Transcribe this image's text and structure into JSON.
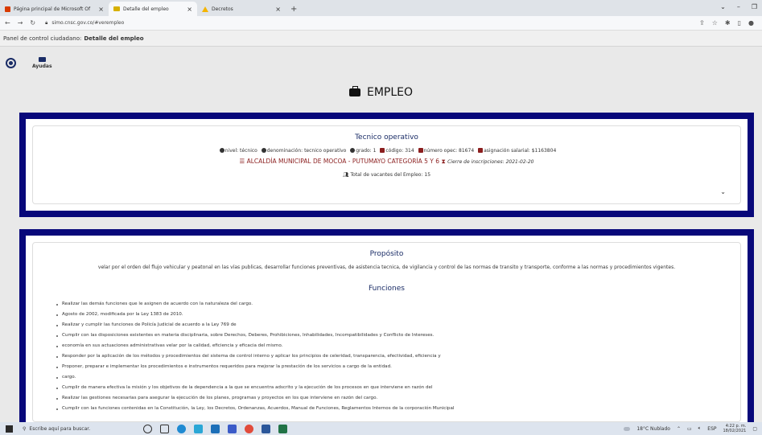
{
  "browser": {
    "tabs": [
      {
        "label": "Página principal de Microsoft Of",
        "icon": "office-icon",
        "color": "#d83b01"
      },
      {
        "label": "Detalle del empleo",
        "icon": "folder-icon",
        "color": "#d7b000",
        "active": true
      },
      {
        "label": "Decretos",
        "icon": "drive-icon",
        "color": "#f4b400"
      }
    ],
    "url": "simo.cnsc.gov.co/#verempleo"
  },
  "breadcrumb": {
    "prefix": "Panel de control ciudadano:",
    "current": "Detalle del empleo"
  },
  "help": {
    "label": "Ayudas"
  },
  "heading": {
    "title": "EMPLEO"
  },
  "job": {
    "title": "Tecnico operativo",
    "nivel": "nivel: técnico",
    "denominacion": "denominación: tecnico operativo",
    "grado": "grado: 1",
    "codigo": "código: 314",
    "numero_opec": "número opec: 81674",
    "asignacion": "asignación salarial: $1163804",
    "entity": "ALCALDÍA MUNICIPAL DE MOCOA - PUTUMAYO CATEGORÍA 5 Y 6",
    "cierre": "Cierre de inscripciones: 2021-02-20",
    "vacantes": "Total de vacantes del Empleo: 15"
  },
  "detail": {
    "purpose_title": "Propósito",
    "purpose": "velar por el orden del flujo vehicular y peatonal en las vías publicas, desarrollar funciones preventivas, de asistencia tecnica, de vigilancia y control de las normas de transito y transporte, conforme a las normas y procedimientos vigentes.",
    "functions_title": "Funciones",
    "functions": [
      "Realizar las demás funciones que le asignen de acuerdo con la naturaleza del cargo.",
      "Agosto de 2002, modificada por la Ley 1383 de 2010.",
      "Realizar y cumplir las funciones de Policía Judicial de acuerdo a la Ley 769 de",
      "Cumplir con las disposiciones existentes en materia disciplinaria, sobre Derechos, Deberes, Prohibiciones, Inhabilidades, Incompatibilidades y Conflicto de Intereses.",
      "economía en sus actuaciones administrativas velar por la calidad, eficiencia y eficacia del mismo.",
      "Responder por la aplicación de los métodos y procedimientos del sistema de control interno y aplicar los principios de celeridad, transparencia, efectividad, eficiencia y",
      "Proponer, preparar e implementar los procedimientos e instrumentos requeridos para mejorar la prestación de los servicios a cargo de la entidad.",
      "cargo.",
      "Cumplir de manera efectiva la misión y los objetivos de la dependencia a la que se encuentra adscrito y la ejecución de los procesos en que interviene en razón del",
      "Realizar las gestiones necesarias para asegurar la ejecución de los planes, programas y proyectos en los que interviene en razón del cargo.",
      "Cumplir con las funciones contenidas en la Constitución, la Ley, los Decretos, Ordenanzas, Acuerdos, Manual de Funciones, Reglamentos Internos de la corporación Municipal"
    ]
  },
  "taskbar": {
    "search_placeholder": "Escribe aquí para buscar.",
    "weather": "18°C Nublado",
    "lang": "ESP",
    "time": "4:22 p. m.",
    "date": "18/02/2021"
  },
  "colors": {
    "navy": "#08087a",
    "title_blue": "#1a2c66",
    "entity_red": "#8b1e1e"
  }
}
